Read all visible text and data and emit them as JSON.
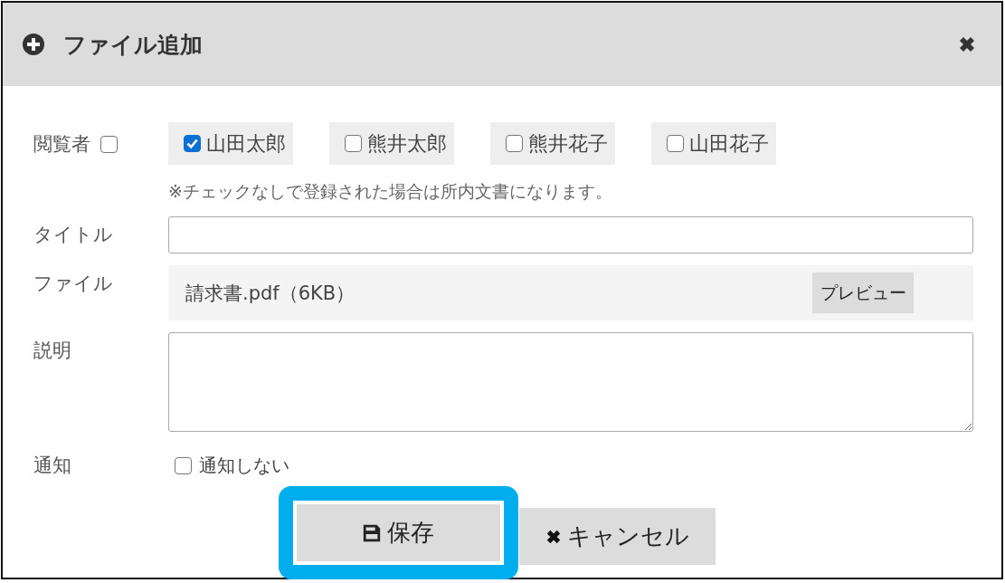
{
  "dialog": {
    "title": "ファイル追加"
  },
  "viewers": {
    "label": "閲覧者",
    "all_checked": false,
    "options": [
      {
        "name": "山田太郎",
        "checked": true
      },
      {
        "name": "熊井太郎",
        "checked": false
      },
      {
        "name": "熊井花子",
        "checked": false
      },
      {
        "name": "山田花子",
        "checked": false
      }
    ],
    "note": "※チェックなしで登録された場合は所内文書になります。"
  },
  "title_field": {
    "label": "タイトル"
  },
  "file": {
    "label": "ファイル",
    "file_name": "請求書.pdf（6KB）",
    "preview_button": "プレビュー"
  },
  "description": {
    "label": "説明"
  },
  "notify": {
    "label": "通知",
    "option": {
      "label": "通知しない",
      "checked": false
    }
  },
  "buttons": [
    {
      "label": "保存",
      "kind": "save",
      "highlighted": true
    },
    {
      "label": "キャンセル",
      "kind": "cancel",
      "highlighted": false
    }
  ]
}
